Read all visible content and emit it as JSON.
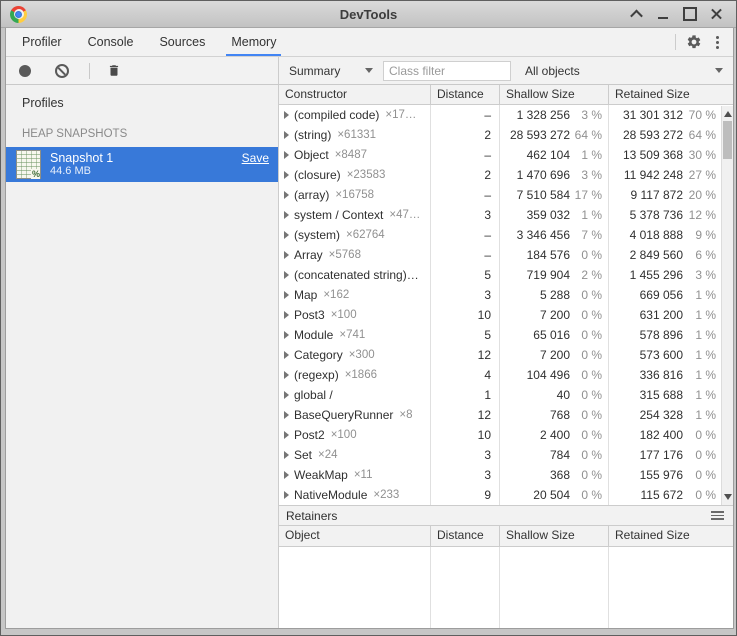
{
  "window": {
    "title": "DevTools"
  },
  "tabs": [
    {
      "label": "Profiler",
      "active": false
    },
    {
      "label": "Console",
      "active": false
    },
    {
      "label": "Sources",
      "active": false
    },
    {
      "label": "Memory",
      "active": true
    }
  ],
  "toolbar": {
    "view_select_value": "Summary",
    "class_filter_placeholder": "Class filter",
    "objects_select_value": "All objects"
  },
  "sidebar": {
    "profiles_label": "Profiles",
    "section_label": "HEAP SNAPSHOTS",
    "snapshot": {
      "title": "Snapshot 1",
      "size": "44.6 MB",
      "save_label": "Save"
    }
  },
  "grid": {
    "columns": [
      "Constructor",
      "Distance",
      "Shallow Size",
      "Retained Size"
    ],
    "rows": [
      {
        "name": "(compiled code)",
        "count": "×17…",
        "distance": "–",
        "shallow": "1 328 256",
        "shallow_pct": "3 %",
        "retained": "31 301 312",
        "retained_pct": "70 %"
      },
      {
        "name": "(string)",
        "count": "×61331",
        "distance": "2",
        "shallow": "28 593 272",
        "shallow_pct": "64 %",
        "retained": "28 593 272",
        "retained_pct": "64 %"
      },
      {
        "name": "Object",
        "count": "×8487",
        "distance": "–",
        "shallow": "462 104",
        "shallow_pct": "1 %",
        "retained": "13 509 368",
        "retained_pct": "30 %"
      },
      {
        "name": "(closure)",
        "count": "×23583",
        "distance": "2",
        "shallow": "1 470 696",
        "shallow_pct": "3 %",
        "retained": "11 942 248",
        "retained_pct": "27 %"
      },
      {
        "name": "(array)",
        "count": "×16758",
        "distance": "–",
        "shallow": "7 510 584",
        "shallow_pct": "17 %",
        "retained": "9 117 872",
        "retained_pct": "20 %"
      },
      {
        "name": "system / Context",
        "count": "×47…",
        "distance": "3",
        "shallow": "359 032",
        "shallow_pct": "1 %",
        "retained": "5 378 736",
        "retained_pct": "12 %"
      },
      {
        "name": "(system)",
        "count": "×62764",
        "distance": "–",
        "shallow": "3 346 456",
        "shallow_pct": "7 %",
        "retained": "4 018 888",
        "retained_pct": "9 %"
      },
      {
        "name": "Array",
        "count": "×5768",
        "distance": "–",
        "shallow": "184 576",
        "shallow_pct": "0 %",
        "retained": "2 849 560",
        "retained_pct": "6 %"
      },
      {
        "name": "(concatenated string)…",
        "count": "",
        "distance": "5",
        "shallow": "719 904",
        "shallow_pct": "2 %",
        "retained": "1 455 296",
        "retained_pct": "3 %"
      },
      {
        "name": "Map",
        "count": "×162",
        "distance": "3",
        "shallow": "5 288",
        "shallow_pct": "0 %",
        "retained": "669 056",
        "retained_pct": "1 %"
      },
      {
        "name": "Post3",
        "count": "×100",
        "distance": "10",
        "shallow": "7 200",
        "shallow_pct": "0 %",
        "retained": "631 200",
        "retained_pct": "1 %"
      },
      {
        "name": "Module",
        "count": "×741",
        "distance": "5",
        "shallow": "65 016",
        "shallow_pct": "0 %",
        "retained": "578 896",
        "retained_pct": "1 %"
      },
      {
        "name": "Category",
        "count": "×300",
        "distance": "12",
        "shallow": "7 200",
        "shallow_pct": "0 %",
        "retained": "573 600",
        "retained_pct": "1 %"
      },
      {
        "name": "(regexp)",
        "count": "×1866",
        "distance": "4",
        "shallow": "104 496",
        "shallow_pct": "0 %",
        "retained": "336 816",
        "retained_pct": "1 %"
      },
      {
        "name": "global /",
        "count": "",
        "distance": "1",
        "shallow": "40",
        "shallow_pct": "0 %",
        "retained": "315 688",
        "retained_pct": "1 %"
      },
      {
        "name": "BaseQueryRunner",
        "count": "×8",
        "distance": "12",
        "shallow": "768",
        "shallow_pct": "0 %",
        "retained": "254 328",
        "retained_pct": "1 %"
      },
      {
        "name": "Post2",
        "count": "×100",
        "distance": "10",
        "shallow": "2 400",
        "shallow_pct": "0 %",
        "retained": "182 400",
        "retained_pct": "0 %"
      },
      {
        "name": "Set",
        "count": "×24",
        "distance": "3",
        "shallow": "784",
        "shallow_pct": "0 %",
        "retained": "177 176",
        "retained_pct": "0 %"
      },
      {
        "name": "WeakMap",
        "count": "×11",
        "distance": "3",
        "shallow": "368",
        "shallow_pct": "0 %",
        "retained": "155 976",
        "retained_pct": "0 %"
      },
      {
        "name": "NativeModule",
        "count": "×233",
        "distance": "9",
        "shallow": "20 504",
        "shallow_pct": "0 %",
        "retained": "115 672",
        "retained_pct": "0 %"
      }
    ]
  },
  "retainers": {
    "title": "Retainers",
    "columns": [
      "Object",
      "Distance",
      "Shallow Size",
      "Retained Size"
    ]
  },
  "icons": {
    "chrome": "chrome-logo",
    "window_controls": [
      "shade-icon",
      "minimize-icon",
      "maximize-icon",
      "close-icon"
    ],
    "record": "filled-circle",
    "clear": "circle-slash",
    "delete": "trash",
    "settings": "gear",
    "more": "kebab-vertical",
    "expand": "triangle-right",
    "retainers_menu": "hamburger"
  },
  "colors": {
    "accent": "#3879d9",
    "tab_underline": "#4285f4"
  }
}
